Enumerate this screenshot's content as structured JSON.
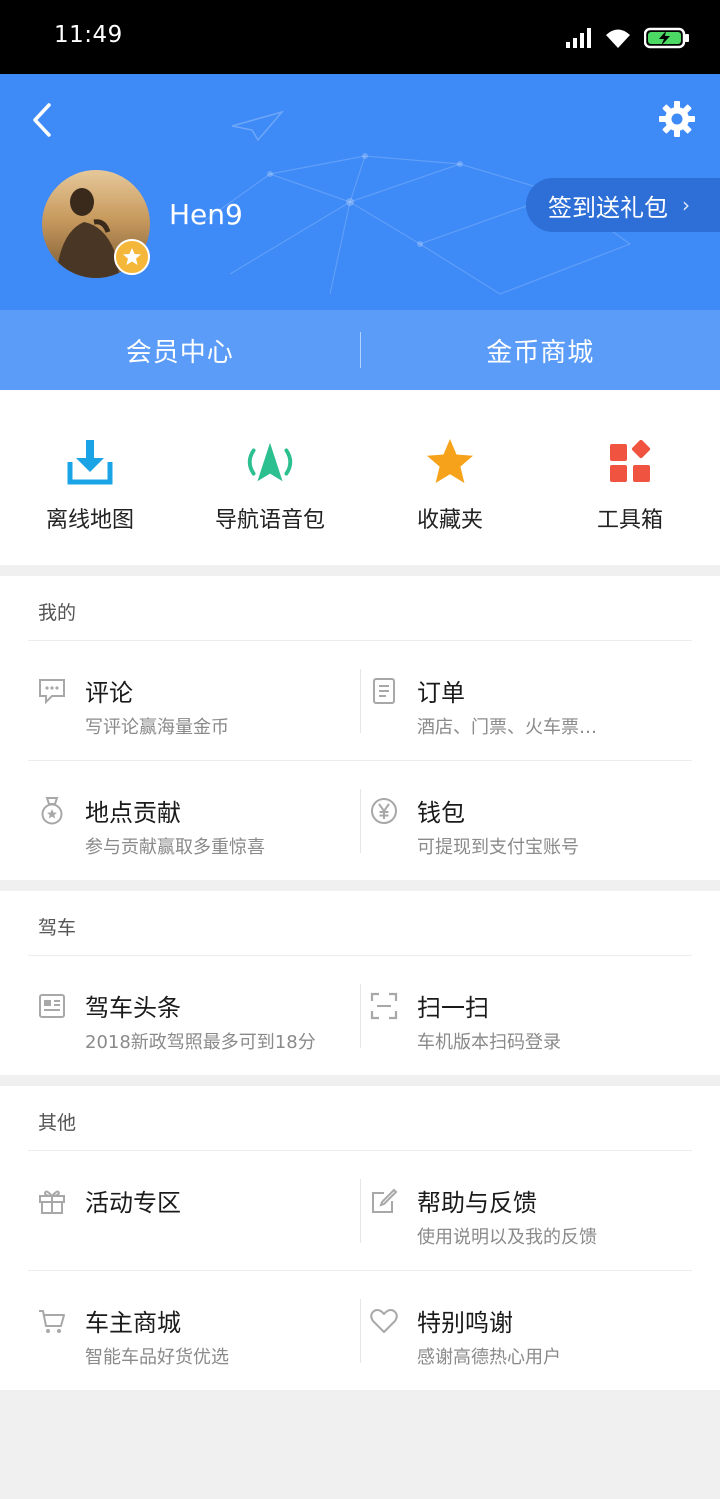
{
  "status": {
    "time": "11:49"
  },
  "profile": {
    "username": "Hen9",
    "checkin_label": "签到送礼包",
    "tabs": [
      {
        "label": "会员中心"
      },
      {
        "label": "金币商城"
      }
    ]
  },
  "quick_actions": [
    {
      "label": "离线地图",
      "icon": "download-icon",
      "color": "#1aa4e6"
    },
    {
      "label": "导航语音包",
      "icon": "navigation-icon",
      "color": "#2cbf8f"
    },
    {
      "label": "收藏夹",
      "icon": "star-icon",
      "color": "#f7a21b"
    },
    {
      "label": "工具箱",
      "icon": "toolbox-icon",
      "color": "#f0533f"
    }
  ],
  "sections": [
    {
      "title": "我的",
      "rows": [
        [
          {
            "title": "评论",
            "subtitle": "写评论赢海量金币",
            "icon": "comment-icon"
          },
          {
            "title": "订单",
            "subtitle": "酒店、门票、火车票…",
            "icon": "order-icon"
          }
        ],
        [
          {
            "title": "地点贡献",
            "subtitle": "参与贡献赢取多重惊喜",
            "icon": "medal-icon"
          },
          {
            "title": "钱包",
            "subtitle": "可提现到支付宝账号",
            "icon": "yen-icon"
          }
        ]
      ]
    },
    {
      "title": "驾车",
      "rows": [
        [
          {
            "title": "驾车头条",
            "subtitle": "2018新政驾照最多可到18分",
            "icon": "news-icon"
          },
          {
            "title": "扫一扫",
            "subtitle": "车机版本扫码登录",
            "icon": "scan-icon"
          }
        ]
      ]
    },
    {
      "title": "其他",
      "rows": [
        [
          {
            "title": "活动专区",
            "subtitle": "",
            "icon": "gift-icon"
          },
          {
            "title": "帮助与反馈",
            "subtitle": "使用说明以及我的反馈",
            "icon": "edit-icon"
          }
        ],
        [
          {
            "title": "车主商城",
            "subtitle": "智能车品好货优选",
            "icon": "cart-icon"
          },
          {
            "title": "特别鸣谢",
            "subtitle": "感谢高德热心用户",
            "icon": "heart-icon"
          }
        ]
      ]
    }
  ],
  "colors": {
    "header": "#3e8af7",
    "header_tabs": "#5a9cf8",
    "checkin": "#2d6fd6"
  }
}
